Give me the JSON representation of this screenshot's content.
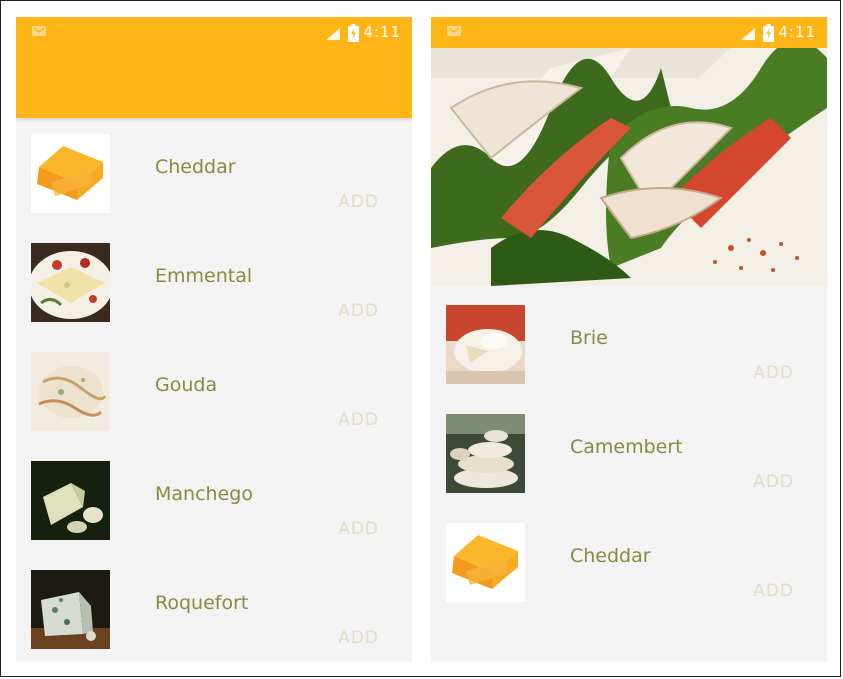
{
  "status_bar": {
    "time": "4:11"
  },
  "left_screen": {
    "items": [
      {
        "name": "Cheddar",
        "action": "ADD",
        "icon": "cheddar-wedge-image"
      },
      {
        "name": "Emmental",
        "action": "ADD",
        "icon": "emmental-plate-image"
      },
      {
        "name": "Gouda",
        "action": "ADD",
        "icon": "gouda-slice-image"
      },
      {
        "name": "Manchego",
        "action": "ADD",
        "icon": "manchego-block-image"
      },
      {
        "name": "Roquefort",
        "action": "ADD",
        "icon": "roquefort-wedge-image"
      }
    ]
  },
  "right_screen": {
    "header_image": "sandwich-banner-image",
    "items": [
      {
        "name": "Brie",
        "action": "ADD",
        "icon": "brie-wheel-image"
      },
      {
        "name": "Camembert",
        "action": "ADD",
        "icon": "camembert-stack-image"
      },
      {
        "name": "Cheddar",
        "action": "ADD",
        "icon": "cheddar-wedge-image"
      }
    ]
  },
  "colors": {
    "primary": "#ffb515",
    "item_text": "#8a8a3f",
    "action_text": "#e4ddc6",
    "background": "#f3f3f3"
  }
}
